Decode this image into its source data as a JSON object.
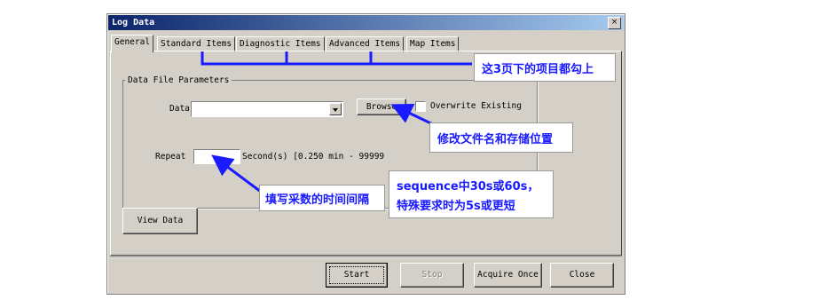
{
  "dialog": {
    "title": "Log Data",
    "close_glyph": "×"
  },
  "tabs": [
    "General",
    "Standard Items",
    "Diagnostic Items",
    "Advanced Items",
    "Map Items"
  ],
  "group": {
    "legend": "Data File Parameters"
  },
  "fields": {
    "data_file_label": "Data",
    "data_file_value": "",
    "browse_label": "Browse",
    "overwrite_label": "Overwrite Existing",
    "overwrite_checked": false,
    "repeat_label": "Repeat",
    "repeat_value": "",
    "repeat_range": "Second(s) [0.250 min - 99999"
  },
  "buttons": {
    "view_data": "View Data",
    "start": "Start",
    "stop": "Stop",
    "acquire_once": "Acquire Once",
    "close": "Close"
  },
  "annotations": {
    "tabs_note": "这3页下的项目都勾上",
    "browse_note": "修改文件名和存储位置",
    "repeat_note": "填写采数的时间间隔",
    "sequence_note_1": "sequence中30s或60s，",
    "sequence_note_2": "特殊要求时为5s或更短"
  },
  "colors": {
    "annotation": "#1a1aff",
    "titlebar_start": "#0a246a",
    "titlebar_end": "#a6caf0",
    "face": "#d4d0c8"
  }
}
